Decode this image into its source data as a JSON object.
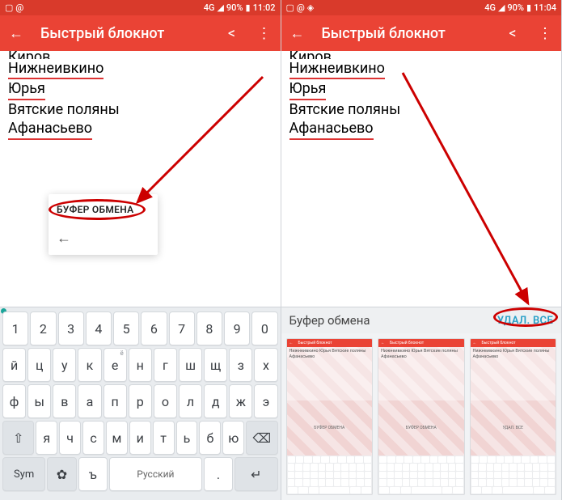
{
  "left": {
    "status": {
      "net": "4G",
      "battery": "90%",
      "time": "11:02"
    },
    "app_title": "Быстрый блокнот",
    "lines": {
      "partial": "Киров",
      "l1": "Нижнеивкино",
      "l2": "Юрья",
      "l3": "Вятские поляны",
      "l4": "Афанасьево"
    },
    "popup_label": "БУФЕР ОБМЕНА",
    "popup_back": "←",
    "nums": [
      "1",
      "2",
      "3",
      "4",
      "5",
      "6",
      "7",
      "8",
      "9",
      "0"
    ],
    "row1": [
      "й",
      "ц",
      "у",
      "к",
      "е",
      "н",
      "г",
      "ш",
      "щ",
      "з",
      "х"
    ],
    "row1_sups": [
      "",
      "",
      "",
      "",
      "ё",
      "",
      "",
      "",
      "",
      "",
      ""
    ],
    "row2": [
      "ф",
      "ы",
      "в",
      "а",
      "п",
      "р",
      "о",
      "л",
      "д",
      "ж",
      "э"
    ],
    "row3_shift": "⇧",
    "row3": [
      "я",
      "ч",
      "с",
      "м",
      "и",
      "т",
      "ь",
      "б",
      "ю"
    ],
    "row3_del": "⌫",
    "row4_sym": "Sym",
    "row4_gear": "✿",
    "row4_ext": "ъ",
    "row4_space": "Русский",
    "row4_dot": ".",
    "row4_ret": "↵"
  },
  "right": {
    "status": {
      "net": "4G",
      "battery": "90%",
      "time": "11:04"
    },
    "app_title": "Быстрый блокнот",
    "lines": {
      "partial": "Киров",
      "l1": "Нижнеивкино",
      "l2": "Юрья",
      "l3": "Вятские поляны",
      "l4": "Афанасьево"
    },
    "clip_title": "Буфер обмена",
    "clip_del": "УДАЛ. ВСЕ",
    "thumb_title": "Быстрый блокнот",
    "thumb_lines": "Нижнеивкино\nЮрья\nВятские поляны\nАфанасьево",
    "thumb_popup1": "БУФЕР ОБМЕНА",
    "thumb_popup2": "БУФЕР ОБМЕНА",
    "thumb_popup3": "УДАЛ. ВСЕ"
  }
}
